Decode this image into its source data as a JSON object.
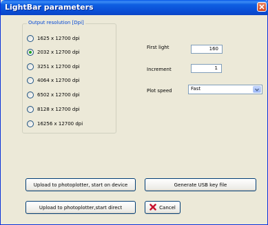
{
  "window": {
    "title": "LightBar parameters"
  },
  "resolution_group": {
    "legend": "Output resolution [Dpi]",
    "options": [
      {
        "label": "1625 x 12700 dpi",
        "checked": false
      },
      {
        "label": "2032 x 12700 dpi",
        "checked": true
      },
      {
        "label": "3251 x 12700 dpi",
        "checked": false
      },
      {
        "label": "4064 x 12700 dpi",
        "checked": false
      },
      {
        "label": "6502 x 12700 dpi",
        "checked": false
      },
      {
        "label": "8128 x 12700 dpi",
        "checked": false
      },
      {
        "label": "16256 x 12700 dpi",
        "checked": false
      }
    ]
  },
  "fields": {
    "first_light": {
      "label": "First light",
      "value": "160"
    },
    "increment": {
      "label": "Increment",
      "value": "1"
    },
    "plot_speed": {
      "label": "Plot speed",
      "value": "Fast"
    }
  },
  "buttons": {
    "upload_start_on_device": "Upload to photoplotter, start on device",
    "generate_usb_key": "Generate USB key file",
    "upload_start_direct": "Upload to photoplotter,start direct",
    "cancel": "Cancel"
  },
  "colors": {
    "titlebar": "#0a4fd6",
    "window_bg": "#ece9d8",
    "legend_text": "#0046d5",
    "radio_checked": "#21a121"
  },
  "icons": {
    "close": "close-icon",
    "cancel": "x-icon",
    "dropdown": "chevron-down-icon"
  }
}
